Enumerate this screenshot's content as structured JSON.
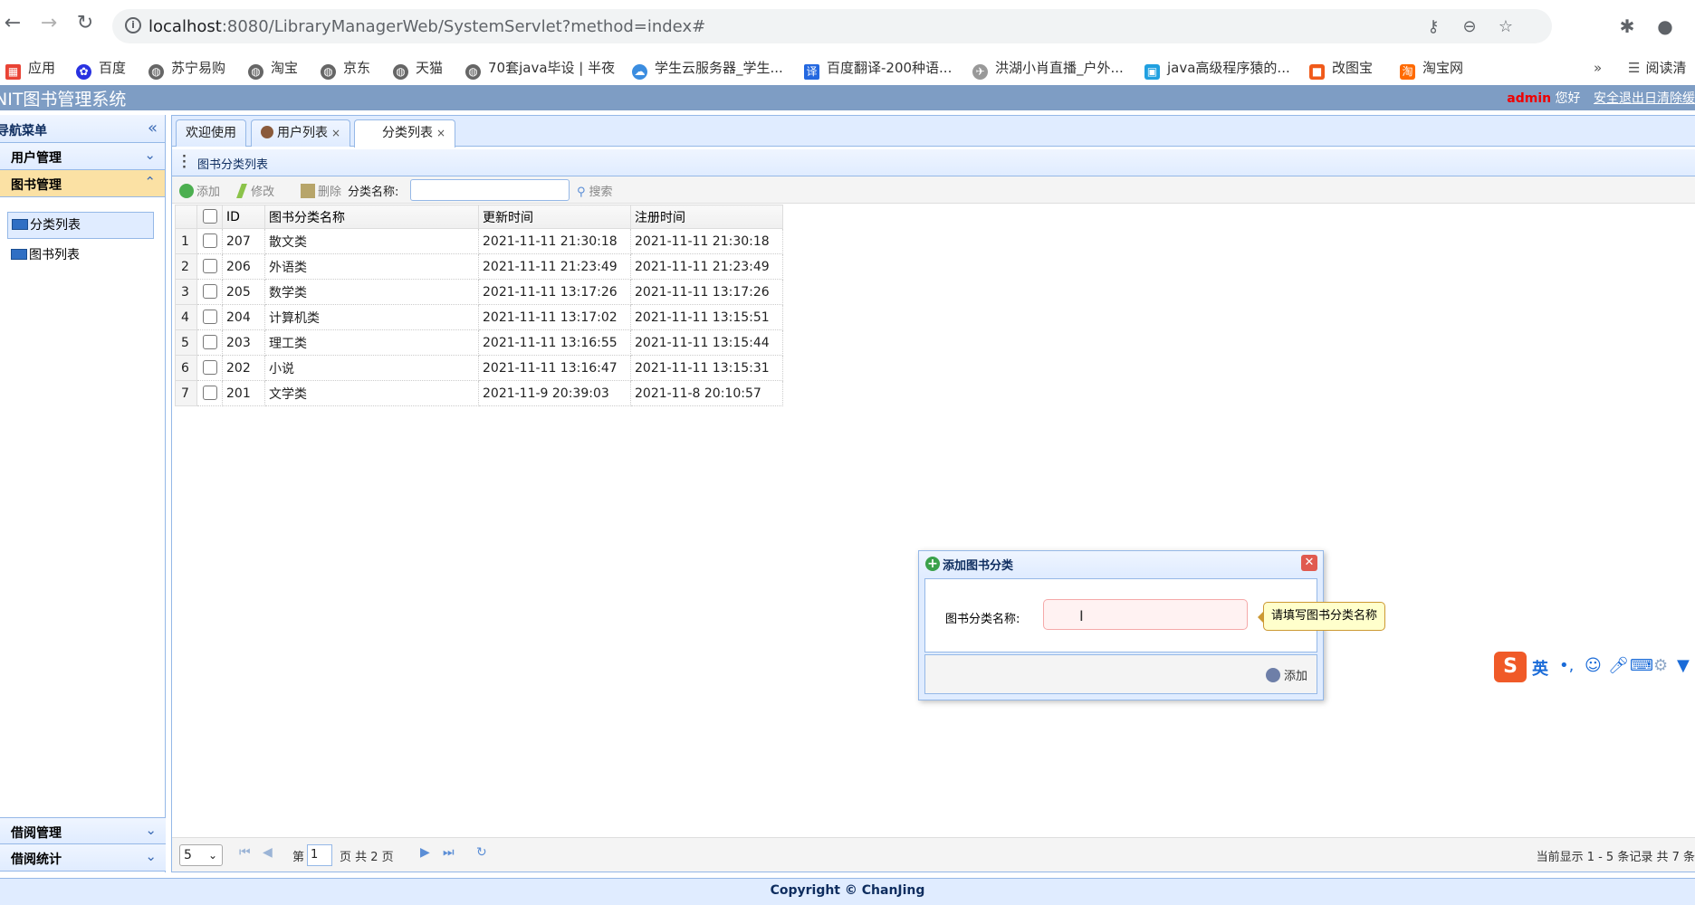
{
  "browser": {
    "url_host": "localhost",
    "url_rest": ":8080/LibraryManagerWeb/SystemServlet?method=index#",
    "bookmarks": [
      "应用",
      "百度",
      "苏宁易购",
      "淘宝",
      "京东",
      "天猫",
      "70套java毕设 | 半夜",
      "学生云服务器_学生...",
      "百度翻译-200种语...",
      "洪湖小肖直播_户外...",
      "java高级程序猿的...",
      "改图宝",
      "淘宝网"
    ],
    "more": "»",
    "reading_mode": "阅读清"
  },
  "header": {
    "title": "NIT图书管理系统",
    "user": "admin",
    "greeting": "您好",
    "logout": "安全退出日清除缓"
  },
  "sidebar": {
    "title": "导航菜单",
    "groups": [
      {
        "label": "用户管理"
      },
      {
        "label": "图书管理",
        "items": [
          "分类列表",
          "图书列表"
        ]
      },
      {
        "label": "借阅管理"
      },
      {
        "label": "借阅统计"
      }
    ]
  },
  "tabs": [
    {
      "label": "欢迎使用"
    },
    {
      "label": "用户列表",
      "close": "×"
    },
    {
      "label": "分类列表",
      "close": "×"
    }
  ],
  "panel": {
    "title": "图书分类列表"
  },
  "toolbar": {
    "add": "添加",
    "edit": "修改",
    "delete": "删除",
    "filter_label": "分类名称:",
    "filter_value": "",
    "search": "搜索"
  },
  "grid": {
    "columns": [
      "ID",
      "图书分类名称",
      "更新时间",
      "注册时间"
    ],
    "rows": [
      {
        "n": "1",
        "id": "207",
        "name": "散文类",
        "updated": "2021-11-11 21:30:18",
        "registered": "2021-11-11 21:30:18"
      },
      {
        "n": "2",
        "id": "206",
        "name": "外语类",
        "updated": "2021-11-11 21:23:49",
        "registered": "2021-11-11 21:23:49"
      },
      {
        "n": "3",
        "id": "205",
        "name": "数学类",
        "updated": "2021-11-11 13:17:26",
        "registered": "2021-11-11 13:17:26"
      },
      {
        "n": "4",
        "id": "204",
        "name": "计算机类",
        "updated": "2021-11-11 13:17:02",
        "registered": "2021-11-11 13:15:51"
      },
      {
        "n": "5",
        "id": "203",
        "name": "理工类",
        "updated": "2021-11-11 13:16:55",
        "registered": "2021-11-11 13:15:44"
      },
      {
        "n": "6",
        "id": "202",
        "name": "小说",
        "updated": "2021-11-11 13:16:47",
        "registered": "2021-11-11 13:15:31"
      },
      {
        "n": "7",
        "id": "201",
        "name": "文学类",
        "updated": "2021-11-9 20:39:03",
        "registered": "2021-11-8 20:10:57"
      }
    ]
  },
  "dialog": {
    "title": "添加图书分类",
    "field_label": "图书分类名称:",
    "field_value": "",
    "tooltip": "请填写图书分类名称",
    "add_button": "添加"
  },
  "pager": {
    "page_size": "5",
    "page_prefix": "第",
    "page_number": "1",
    "page_suffix": "页 共 2 页",
    "info": "当前显示 1 - 5 条记录 共 7 条"
  },
  "ime": {
    "mode": "英"
  },
  "footer": {
    "text": "Copyright © ChanJing"
  }
}
